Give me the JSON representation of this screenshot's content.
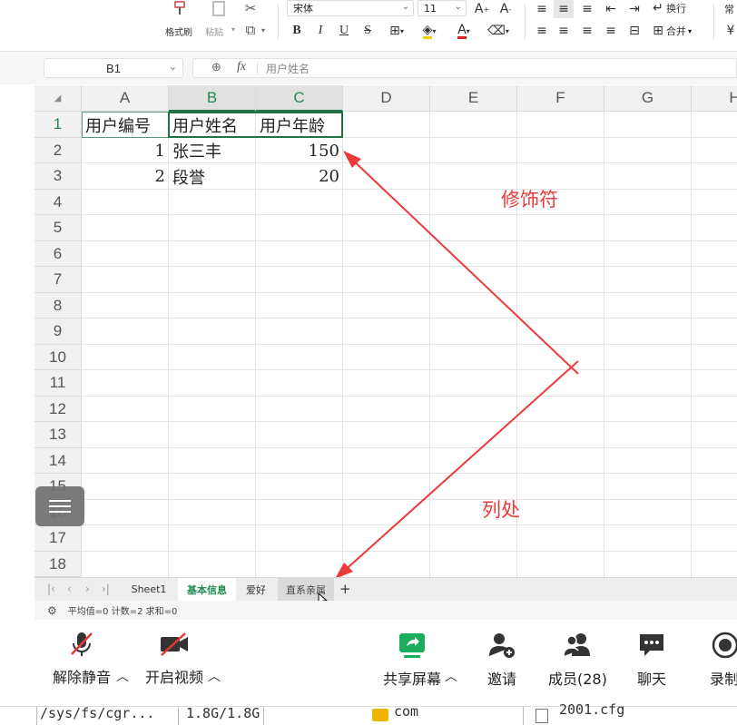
{
  "ribbon": {
    "format_painter": "格式刷",
    "paste": "粘贴",
    "font_name": "宋体",
    "font_size": "11",
    "bold": "B",
    "italic": "I",
    "underline": "U",
    "strike": "S",
    "font_color_letter": "A",
    "wrap": "换行",
    "merge": "合并",
    "cut_off_label": "常"
  },
  "formula_bar": {
    "name_box": "B1",
    "fx": "fx",
    "formula": "用户姓名"
  },
  "sheet": {
    "columns": [
      "A",
      "B",
      "C",
      "D",
      "E",
      "F",
      "G",
      "H"
    ],
    "rows": [
      "1",
      "2",
      "3",
      "4",
      "5",
      "6",
      "7",
      "8",
      "9",
      "10",
      "11",
      "12",
      "13",
      "14",
      "15",
      "16",
      "17",
      "18"
    ],
    "cells": {
      "A1": "用户编号",
      "B1": "用户姓名",
      "C1": "用户年龄",
      "A2": "1",
      "B2": "张三丰",
      "C2": "150",
      "A3": "2",
      "B3": "段誉",
      "C3": "20"
    }
  },
  "tabs": [
    "Sheet1",
    "基本信息",
    "爱好",
    "直系亲属"
  ],
  "active_tab": "基本信息",
  "status": "平均值=0  计数=2  求和=0",
  "annotations": {
    "top": "修饰符",
    "bottom": "列处",
    "color": "#ec3b3b"
  },
  "meeting": {
    "unmute": "解除静音",
    "video": "开启视频",
    "share": "共享屏幕",
    "invite": "邀请",
    "members": "成员(28)",
    "chat": "聊天",
    "record": "录制"
  },
  "bottom_strip": {
    "path": "/sys/fs/cgr...",
    "size": "1.8G/1.8G",
    "item": "com",
    "right": "2001.cfg"
  },
  "colors": {
    "accent_green": "#217346",
    "annotation_red": "#ec3b3b",
    "share_green": "#1aad5b"
  }
}
